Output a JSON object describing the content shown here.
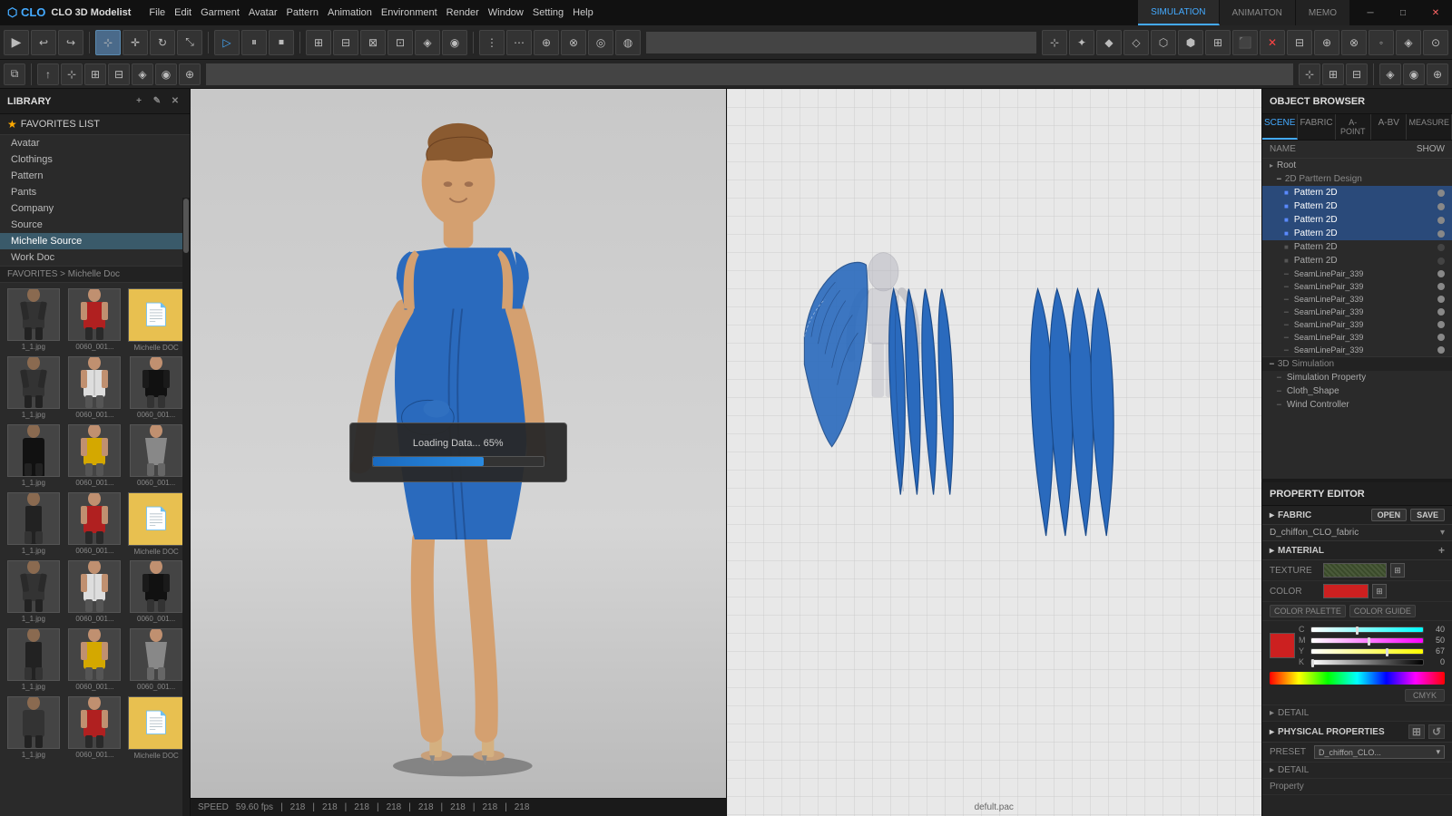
{
  "app": {
    "title": "CLO 3D Modelist",
    "tabs": [
      "SIMULATION",
      "ANIMAITON",
      "MEMO"
    ],
    "active_tab": "SIMULATION"
  },
  "menu": {
    "items": [
      "File",
      "Edit",
      "Garment",
      "Avatar",
      "Pattern",
      "Animation",
      "Environment",
      "Render",
      "Window",
      "Setting",
      "Help"
    ]
  },
  "library": {
    "header": "LIBRARY",
    "favorites_label": "FAVORITES LIST",
    "items": [
      "Avatar",
      "Clothings",
      "Pattern",
      "Pants",
      "Company",
      "Source",
      "Michelle Source",
      "Work Doc"
    ],
    "active_item": "Michelle Source",
    "breadcrumb": "FAVORITES > Michelle Doc"
  },
  "thumbnails": [
    {
      "label": "1_1.jpg",
      "type": "avatar_dark"
    },
    {
      "label": "0060_001...",
      "type": "avatar_red"
    },
    {
      "label": "Michelle DOC",
      "type": "avatar_doc"
    },
    {
      "label": "1_1.jpg",
      "type": "avatar_dark"
    },
    {
      "label": "0060_001...",
      "type": "avatar_white"
    },
    {
      "label": "0060_001...",
      "type": "avatar_jacket"
    },
    {
      "label": "1_1.jpg",
      "type": "avatar_dark"
    },
    {
      "label": "0060_001...",
      "type": "avatar_yellow2"
    },
    {
      "label": "0060_001...",
      "type": "avatar_gray"
    },
    {
      "label": "1_1.jpg",
      "type": "avatar_dark"
    },
    {
      "label": "0060_001...",
      "type": "avatar_red"
    },
    {
      "label": "Michelle DOC",
      "type": "avatar_doc"
    },
    {
      "label": "1_1.jpg",
      "type": "avatar_dark"
    },
    {
      "label": "0060_001...",
      "type": "avatar_white"
    },
    {
      "label": "0060_001...",
      "type": "avatar_jacket"
    },
    {
      "label": "1_1.jpg",
      "type": "avatar_dark"
    },
    {
      "label": "0060_001...",
      "type": "avatar_yellow2"
    },
    {
      "label": "0060_001...",
      "type": "avatar_gray"
    },
    {
      "label": "1_1.jpg",
      "type": "avatar_dark"
    },
    {
      "label": "0060_001...",
      "type": "avatar_red"
    },
    {
      "label": "Michelle DOC",
      "type": "avatar_doc"
    }
  ],
  "loading": {
    "text": "Loading Data... 65%",
    "progress": 65
  },
  "status_bar": {
    "speed_label": "SPEED",
    "speed_val": "59.60 fps",
    "coords": [
      "218",
      "218",
      "218",
      "218",
      "218",
      "218",
      "218",
      "218"
    ]
  },
  "status_bar_2d": {
    "filename": "defult.pac"
  },
  "object_browser": {
    "header": "OBJECT BROWSER",
    "tabs": [
      "SCENE",
      "FABRIC",
      "A-POINT",
      "A-BV",
      "MEASURE"
    ],
    "active_tab": "SCENE",
    "name_label": "NAME",
    "show_btn": "SHOW",
    "tree": [
      {
        "label": "Root",
        "level": 0,
        "type": "folder"
      },
      {
        "label": "2D Parttern Design",
        "level": 1,
        "type": "folder",
        "icon": "▸"
      },
      {
        "label": "Pattern 2D",
        "level": 2,
        "selected": true,
        "dot": true
      },
      {
        "label": "Pattern 2D",
        "level": 2,
        "selected": true,
        "dot": true
      },
      {
        "label": "Pattern 2D",
        "level": 2,
        "selected": true,
        "dot": true
      },
      {
        "label": "Pattern 2D",
        "level": 2,
        "selected": true,
        "dot": true
      },
      {
        "label": "Pattern 2D",
        "level": 2,
        "dot": false
      },
      {
        "label": "Pattern 2D",
        "level": 2,
        "dot": false
      },
      {
        "label": "SeamLinePair_339",
        "level": 2,
        "dot": true
      },
      {
        "label": "SeamLinePair_339",
        "level": 2,
        "dot": true
      },
      {
        "label": "SeamLinePair_339",
        "level": 2,
        "dot": true
      },
      {
        "label": "SeamLinePair_339",
        "level": 2,
        "dot": true
      },
      {
        "label": "SeamLinePair_339",
        "level": 2,
        "dot": true
      },
      {
        "label": "SeamLinePair_339",
        "level": 2,
        "dot": true
      },
      {
        "label": "SeamLinePair_339",
        "level": 2,
        "dot": true
      },
      {
        "label": "3D Simulation",
        "level": 1,
        "type": "section"
      },
      {
        "label": "Simulation Property",
        "level": 2,
        "dot": false
      },
      {
        "label": "Cloth_Shape",
        "level": 2,
        "dot": false
      },
      {
        "label": "Wind Controller",
        "level": 2,
        "dot": false
      }
    ]
  },
  "property_editor": {
    "header": "PROPERTY EDITOR",
    "fabric_section": "FABRIC",
    "open_btn": "OPEN",
    "save_btn": "SAVE",
    "fabric_name": "D_chiffon_CLO_fabric",
    "material_section": "MATERIAL",
    "texture_label": "TEXTURE",
    "color_label": "COLOR",
    "color_palette_btn": "COLOR PALETTE",
    "color_guide_btn": "COLOR GUIDE",
    "cmyk_values": {
      "c": 40,
      "m": 50,
      "y": 67,
      "k": 0
    },
    "cmyk_btn": "CMYK",
    "detail_label": "DETAIL",
    "physical_section": "PHYSICAL PROPERTIES",
    "preset_label": "PRESET",
    "preset_val": "D_chiffon_CLO...",
    "phys_detail_label": "DETAIL"
  }
}
